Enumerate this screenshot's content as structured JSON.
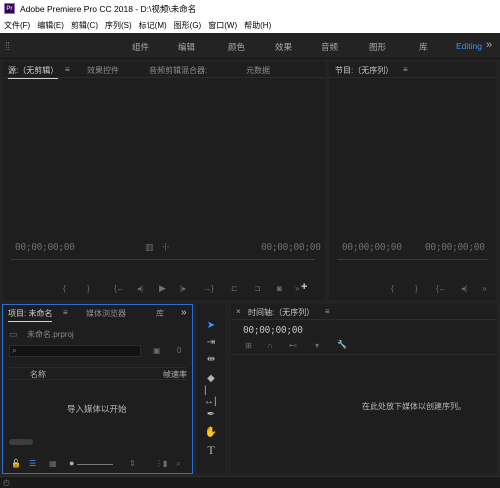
{
  "titlebar": {
    "logo_text": "Pr",
    "title": "Adobe Premiere Pro CC 2018 - D:\\视频\\未命名"
  },
  "menubar": {
    "items": [
      "文件(F)",
      "编辑(E)",
      "剪辑(C)",
      "序列(S)",
      "标记(M)",
      "图形(G)",
      "窗口(W)",
      "帮助(H)"
    ]
  },
  "workspaces": {
    "tabs": [
      "组件",
      "编辑",
      "颜色",
      "效果",
      "音频",
      "图形",
      "库"
    ],
    "active": "Editing",
    "more": "»"
  },
  "source_panel": {
    "tabs": [
      "源:（无剪辑）",
      "效果控件",
      "音频剪辑混合器:",
      "元数据"
    ],
    "menu": "≡",
    "timecode_in": "00;00;00;00",
    "timecode_out": "00;00;00;00",
    "add_button": "+"
  },
  "program_panel": {
    "tab": "节目:（无序列）",
    "menu": "≡",
    "timecode_in": "00;00;00;00",
    "timecode_out": "00;00;00;00"
  },
  "project_panel": {
    "tabs": [
      "项目: 未命名",
      "媒体浏览器",
      "库"
    ],
    "menu": "≡",
    "more": "»",
    "project_file": "未命名.prproj",
    "item_count": "0",
    "columns": [
      "名称",
      "帧速率"
    ],
    "drop_hint": "导入媒体以开始"
  },
  "timeline_panel": {
    "close": "×",
    "tab": "时间轴:（无序列）",
    "menu": "≡",
    "timecode": "00;00;00;00",
    "drop_hint": "在此处放下媒体以创建序列。"
  },
  "colors": {
    "accent": "#3d8fff",
    "panel_bg": "#1e1e1e",
    "app_bg": "#232323",
    "focus_border": "#2a6fd1"
  }
}
